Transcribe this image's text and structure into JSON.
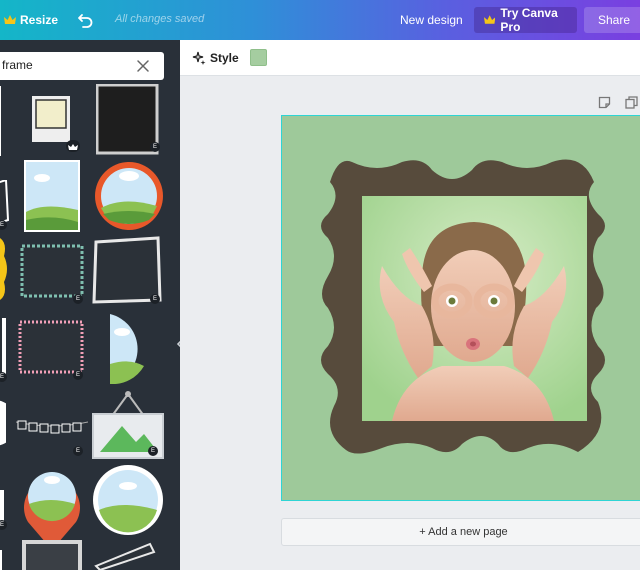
{
  "topbar": {
    "resize_label": "Resize",
    "saved_status": "All changes saved",
    "new_design_label": "New design",
    "try_pro_label": "Try Canva Pro",
    "share_label": "Share"
  },
  "panel": {
    "search": {
      "value": "frame",
      "placeholder": ""
    },
    "badge_letter": "E"
  },
  "editor": {
    "style_label": "Style",
    "selected_color": "#a5cda0"
  },
  "canvas": {
    "background_color": "#9ec99a",
    "frame_color": "#574b3c",
    "photo_description_icon": "woman-goggle-hands-photo"
  },
  "add_page_label": "+ Add a new page",
  "colors": {
    "sidebar": "#293039",
    "accent_gold": "#f5c518",
    "selection_border": "#2ed4d4"
  }
}
